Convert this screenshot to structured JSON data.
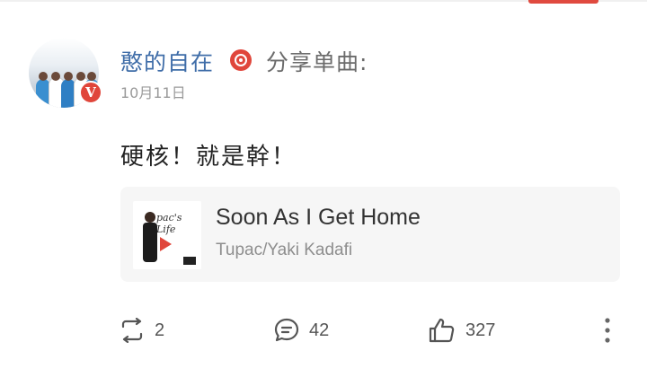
{
  "post": {
    "username": "憨的自在",
    "share_label": "分享单曲:",
    "date": "10月11日",
    "verified_badge": "V",
    "text": "硬核！就是幹！"
  },
  "music": {
    "title": "Soon As I Get Home",
    "artist": "Tupac/Yaki Kadafi",
    "album_art_text": "pac's Life"
  },
  "actions": {
    "repost_count": "2",
    "comment_count": "42",
    "like_count": "327"
  },
  "colors": {
    "username": "#3f6da8",
    "accent": "#e0463b",
    "muted": "#9a9a9a"
  },
  "icons": [
    "music-note-icon",
    "repost-icon",
    "comment-icon",
    "like-icon",
    "more-icon",
    "play-icon"
  ]
}
